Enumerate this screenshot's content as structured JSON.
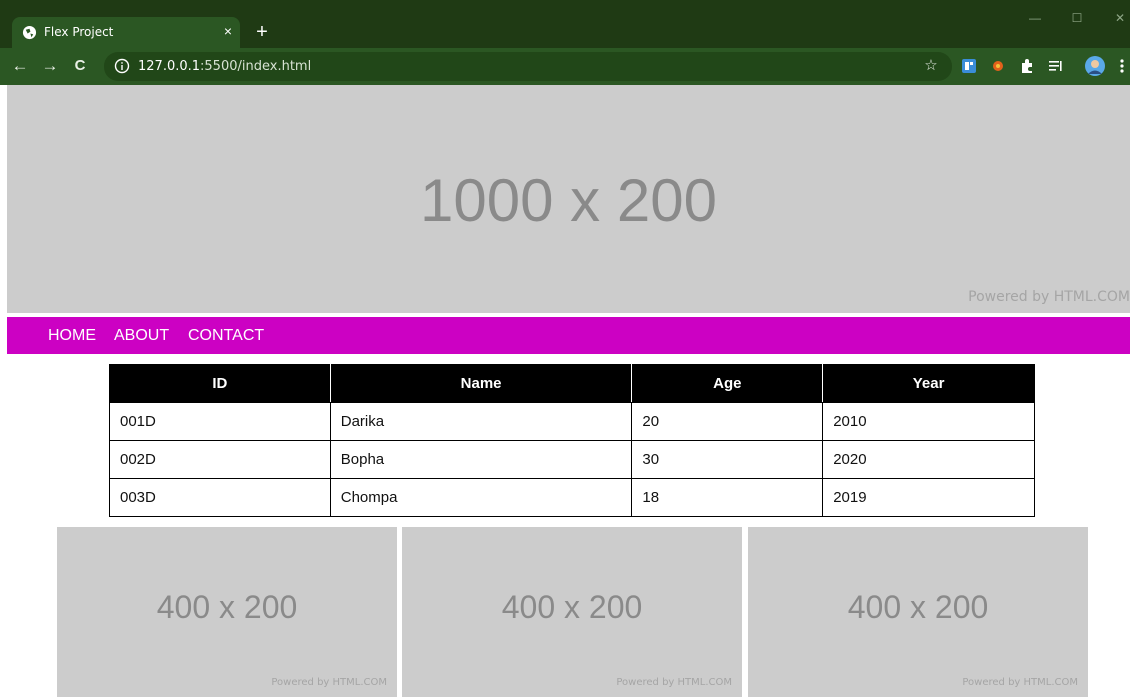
{
  "browser": {
    "tab_title": "Flex Project",
    "tab_close": "×",
    "new_tab": "+",
    "url_host": "127.0.0.1",
    "url_rest": ":5500/index.html",
    "back": "←",
    "forward": "→",
    "reload": "C",
    "star": "☆",
    "minimize": "—",
    "maximize": "☐",
    "close": "✕",
    "theme_color": "#2b5723"
  },
  "hero": {
    "label": "1000 x 200",
    "powered": "Powered by HTML.COM"
  },
  "nav": {
    "items": [
      "HOME",
      "ABOUT",
      "CONTACT"
    ],
    "color": "#cc01c3"
  },
  "table": {
    "headers": [
      "ID",
      "Name",
      "Age",
      "Year"
    ],
    "rows": [
      [
        "001D",
        "Darika",
        "20",
        "2010"
      ],
      [
        "002D",
        "Bopha",
        "30",
        "2020"
      ],
      [
        "003D",
        "Chompa",
        "18",
        "2019"
      ]
    ]
  },
  "thumbnails": [
    {
      "label": "400 x 200",
      "powered": "Powered by HTML.COM"
    },
    {
      "label": "400 x 200",
      "powered": "Powered by HTML.COM"
    },
    {
      "label": "400 x 200",
      "powered": "Powered by HTML.COM"
    }
  ]
}
